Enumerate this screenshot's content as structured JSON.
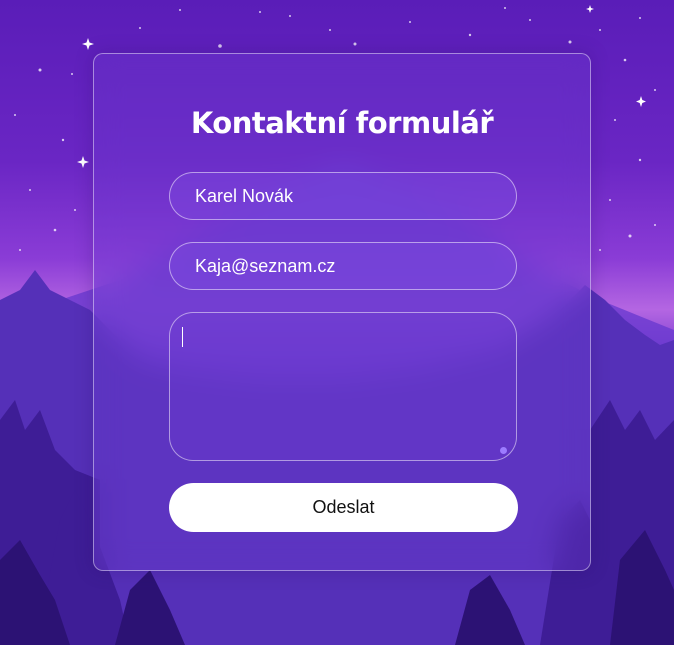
{
  "form": {
    "title": "Kontaktní formulář",
    "name_value": "Karel Novák",
    "email_value": "Kaja@seznam.cz",
    "message_value": "",
    "submit_label": "Odeslat"
  },
  "colors": {
    "sky_top": "#5a1db8",
    "horizon_glow": "#b466e2",
    "forest_dark": "#341486",
    "button_bg": "#ffffff",
    "resize_handle": "#9c7cff"
  }
}
